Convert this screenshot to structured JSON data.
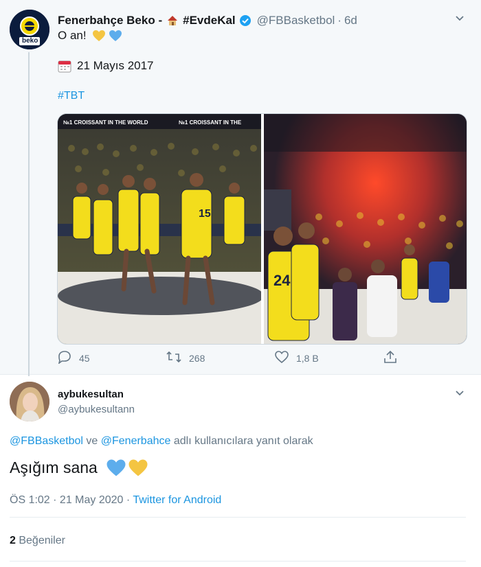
{
  "tweet": {
    "author_name": "Fenerbahçe Beko -",
    "author_hashtag": "#EvdeKal",
    "handle": "@FBBasketbol",
    "time": "6d",
    "text": "O an!",
    "date_line": "21 Mayıs 2017",
    "hashtag": "#TBT",
    "banner_left": "№1 CROISSANT IN THE WORLD",
    "banner_left2": "№1 CROISSANT IN THE",
    "jersey_number": "15",
    "jersey_number2": "24",
    "replies": "45",
    "retweets": "268",
    "likes": "1,8 B",
    "avatar_text": "beko"
  },
  "reply": {
    "author_name": "aybukesultan",
    "handle": "@aybukesultann",
    "mention1": "@FBBasketbol",
    "reply_joiner": " ve ",
    "mention2": "@Fenerbahce",
    "reply_suffix": " adlı kullanıcılara yanıt olarak",
    "text": "Aşığım sana",
    "timestamp": "ÖS 1:02 · 21 May 2020 · ",
    "source": "Twitter for Android",
    "like_count": "2",
    "like_label": " Beğeniler"
  },
  "colors": {
    "accent": "#1b95e0",
    "muted": "#657786",
    "fb_yellow": "#f5d800",
    "fb_navy": "#0b1c3d"
  }
}
